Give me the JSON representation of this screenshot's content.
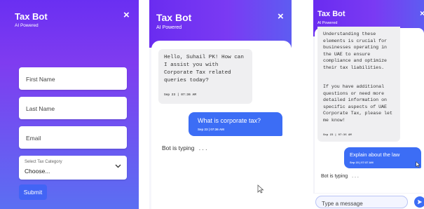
{
  "panel1": {
    "title": "Tax Bot",
    "subtitle": "AI Powered",
    "close_glyph": "×",
    "first_name_placeholder": "First Name",
    "last_name_placeholder": "Last Name",
    "email_placeholder": "Email",
    "select_label": "Select Tax Category",
    "select_value": "Choose...",
    "submit_label": "Submit"
  },
  "panel2": {
    "title": "Tax Bot",
    "subtitle": "AI Powered",
    "close_glyph": "×",
    "bot_message": "Hello, Suhail PK! How can I assist you with Corporate Tax related queries today?",
    "bot_time": "Sep 23 | 07:36 AM",
    "user_message": "What is corporate tax?",
    "user_time": "Sep 23 | 07:36 AM",
    "typing_text": "Bot is typing",
    "typing_dots": ". . ."
  },
  "panel3": {
    "title": "Tax Bot",
    "subtitle": "AI Powered",
    "close_glyph": "×",
    "bot_message_p1": "Understanding these elements is crucial for businesses operating in the UAE to ensure compliance and optimize their tax liabilities.",
    "bot_message_p2": "If you have additional questions or need more detailed information on specific aspects of UAE Corporate Tax, please let me know!",
    "bot_time": "Sep 23 | 07:36 AM",
    "user_message": "Explain about the law",
    "user_time": "Sep 23 | 07:37 AM",
    "typing_text": "Bot is typing",
    "typing_dots": ". . .",
    "input_placeholder": "Type a message"
  },
  "colors": {
    "header_purple": "#6a2cf0",
    "gradient_blue": "#5b6ff2",
    "user_bubble": "#3c6df5",
    "submit_button": "#4264f5"
  },
  "icons": [
    "close-icon",
    "chevron-down-icon",
    "send-icon",
    "mouse-cursor-icon"
  ]
}
